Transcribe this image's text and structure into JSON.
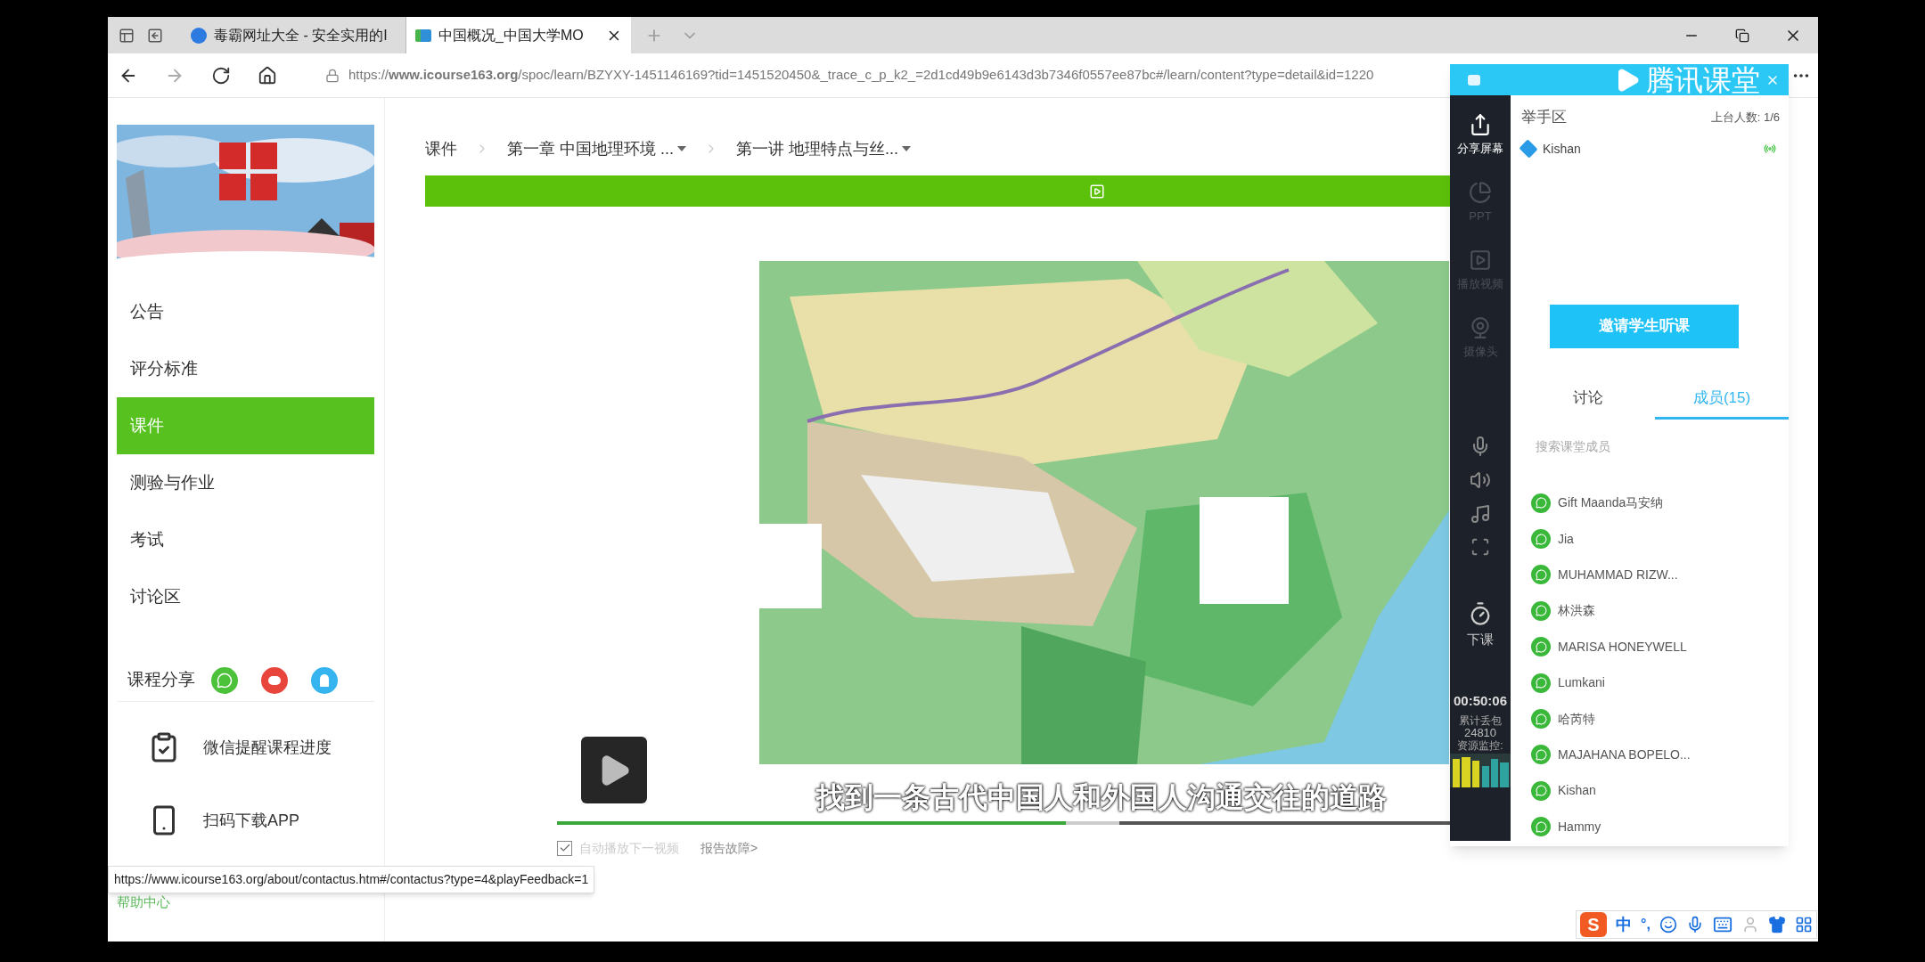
{
  "browser": {
    "tabs": [
      {
        "title": "毒霸网址大全 - 安全实用的I",
        "selected": false
      },
      {
        "title": "中国概况_中国大学MO",
        "selected": true
      }
    ],
    "url": "https://**www.icourse163.org**/spoc/learn/BZYXY-1451146169?tid=1451520450&_trace_c_p_k2_=2d1cd49b9e6143d3b7346f0557ee87bc#/learn/content?type=detail&id=1220"
  },
  "sidebar": {
    "menu": [
      {
        "label": "公告",
        "selected": false
      },
      {
        "label": "评分标准",
        "selected": false
      },
      {
        "label": "课件",
        "selected": true
      },
      {
        "label": "测验与作业",
        "selected": false
      },
      {
        "label": "考试",
        "selected": false
      },
      {
        "label": "讨论区",
        "selected": false
      }
    ],
    "share_label": "课程分享",
    "links": [
      {
        "kind": "reminder",
        "label": "微信提醒课程进度"
      },
      {
        "kind": "app",
        "label": "扫码下载APP"
      }
    ],
    "help": "帮助中心"
  },
  "breadcrumb": [
    {
      "label": "课件",
      "dropdown": false
    },
    {
      "label": "第一章 中国地理环境 ...",
      "dropdown": true
    },
    {
      "label": "第一讲 地理特点与丝...",
      "dropdown": true
    }
  ],
  "player": {
    "subtitle": "找到一条古代中国人和外国人沟通交往的道路",
    "progress": {
      "level": 0.57
    },
    "autoplay": {
      "label": "自动播放下一视频",
      "checked": true
    },
    "report": "报告故障>"
  },
  "tooltip": "https://www.icourse163.org/about/contactus.htm#/contactus?type=4&playFeedback=1",
  "classroom": {
    "title": "腾讯课堂",
    "tools": [
      {
        "kind": "share",
        "label": "分享屏幕",
        "selected": true
      },
      {
        "kind": "ppt",
        "label": "PPT",
        "selected": false
      },
      {
        "kind": "video",
        "label": "播放视频",
        "selected": false
      },
      {
        "kind": "camera",
        "label": "摄像头",
        "selected": false
      }
    ],
    "end_label": "下课",
    "timer": "00:50:06",
    "loss_label": "累计丢包",
    "loss_value": "24810",
    "monitor_label": "资源监控:",
    "hand_up": "举手区",
    "stage_count": "上台人数: 1/6",
    "stage_members": [
      "Kishan"
    ],
    "invite": "邀请学生听课",
    "tabs": [
      {
        "label": "讨论",
        "selected": false
      },
      {
        "label": "成员(15)",
        "selected": true
      }
    ],
    "search_placeholder": "搜索课堂成员",
    "members": [
      "Gift Maanda马安纳",
      "Jia",
      "MUHAMMAD RIZW...",
      "林洪森",
      "MARISA HONEYWELL",
      "Lumkani",
      "哈芮特",
      "MAJAHANA BOPELO...",
      "Kishan",
      "Hammy"
    ]
  },
  "ime": {
    "logo": "S",
    "mode": "中",
    "punct": "°,"
  }
}
